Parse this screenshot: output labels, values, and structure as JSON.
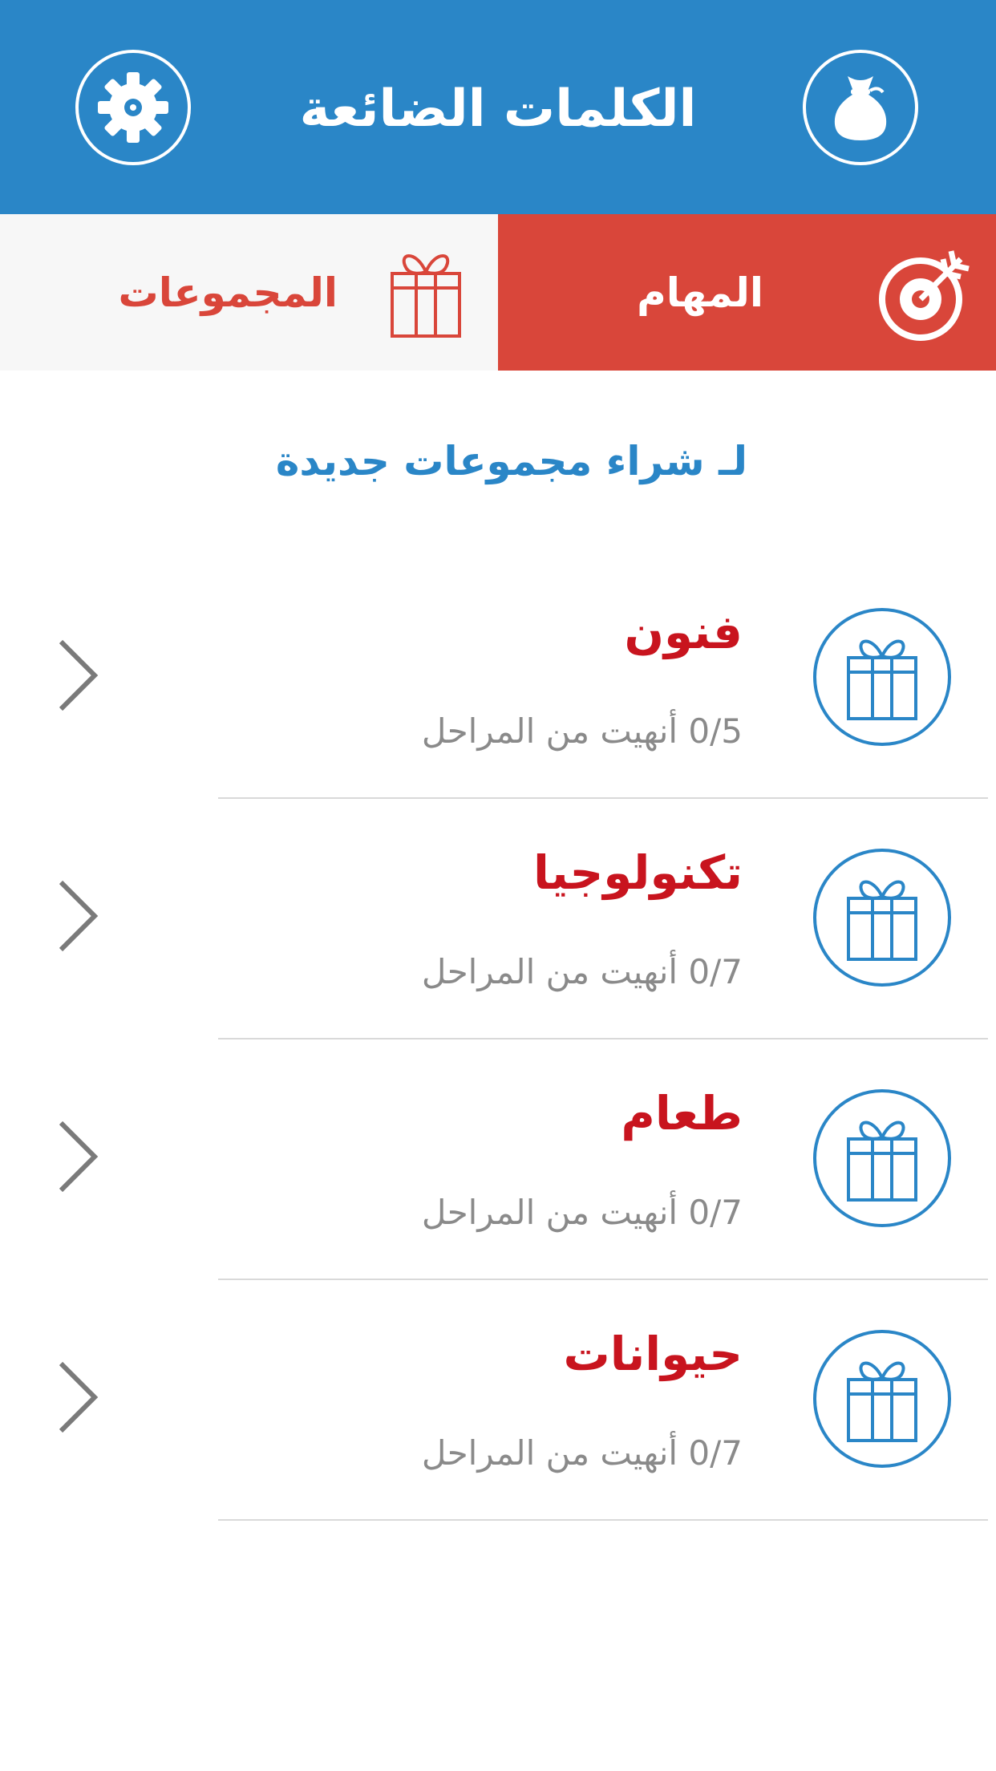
{
  "header": {
    "title": "الكلمات الضائعة",
    "left_icon": "gear-icon",
    "right_icon": "coin-bag-icon"
  },
  "tabs": [
    {
      "label": "المهام",
      "icon": "target-arrow-icon",
      "active": true
    },
    {
      "label": "المجموعات",
      "icon": "gift-icon",
      "active": false
    }
  ],
  "buy_link": "لـ شراء مجموعات جديدة",
  "groups": [
    {
      "title": "فنون",
      "progress": "0/5 أنهيت من المراحل",
      "icon": "gift-icon"
    },
    {
      "title": "تكنولوجيا",
      "progress": "0/7 أنهيت من المراحل",
      "icon": "gift-icon"
    },
    {
      "title": "طعام",
      "progress": "0/7 أنهيت من المراحل",
      "icon": "gift-icon"
    },
    {
      "title": "حيوانات",
      "progress": "0/7 أنهيت من المراحل",
      "icon": "gift-icon"
    }
  ],
  "colors": {
    "header_blue": "#2a86c7",
    "tab_red": "#d9463a",
    "title_red": "#c8141e",
    "muted_gray": "#8a8a8a"
  }
}
